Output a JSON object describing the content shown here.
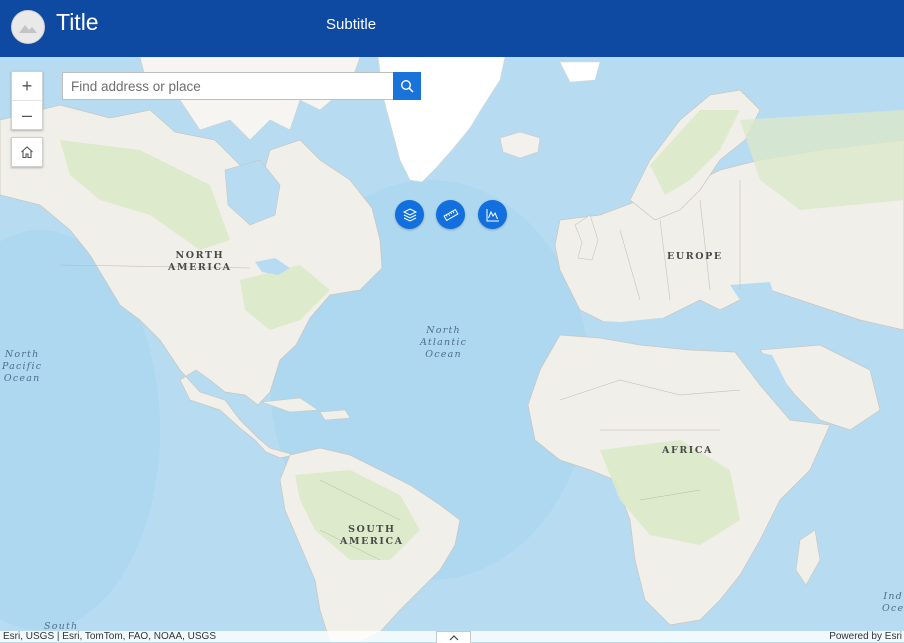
{
  "header": {
    "title": "Title",
    "subtitle": "Subtitle",
    "background": "#0e4aa1",
    "logo_icon": "mountain-landscape-icon"
  },
  "controls": {
    "zoom_in": "+",
    "zoom_out": "–",
    "home_icon": "home-icon"
  },
  "search": {
    "placeholder": "Find address or place",
    "button_icon": "search-icon",
    "accent": "#1a73d9"
  },
  "tools": [
    {
      "name": "layers",
      "icon": "layers-icon"
    },
    {
      "name": "measure",
      "icon": "ruler-icon"
    },
    {
      "name": "elevation-profile",
      "icon": "elevation-chart-icon"
    }
  ],
  "map_labels": {
    "north_america": [
      "NORTH",
      "AMERICA"
    ],
    "south_america": [
      "SOUTH",
      "AMERICA"
    ],
    "europe": "EUROPE",
    "africa": "AFRICA",
    "north_atlantic": [
      "North",
      "Atlantic",
      "Ocean"
    ],
    "north_pacific": [
      "North",
      "Pacific",
      "Ocean"
    ],
    "south_pacific_partial": "South",
    "indian_partial": "Ind",
    "indian_partial2": "Oce"
  },
  "colors": {
    "ocean": "#b7dcf2",
    "land": "#f1efe9",
    "vegetation": "#dbe9c9",
    "ice": "#ffffff"
  },
  "attribution": {
    "left": "Esri, USGS | Esri, TomTom, FAO, NOAA, USGS",
    "right": "Powered by Esri"
  }
}
